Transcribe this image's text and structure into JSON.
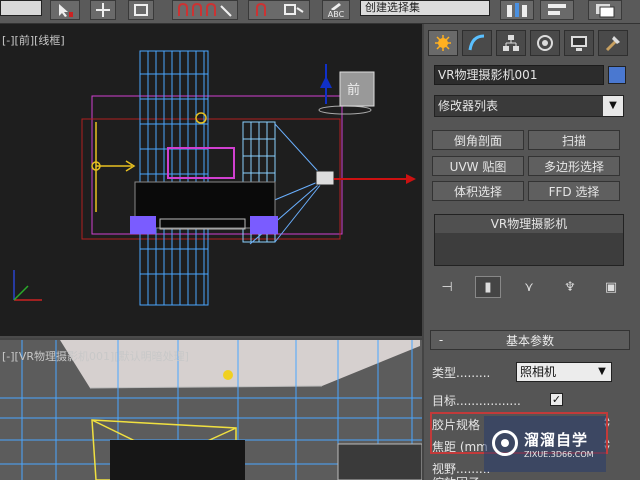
{
  "toolbar": {
    "selection_set": "创建选择集",
    "icons": [
      "select-object-icon",
      "select-move-icon",
      "snap-toggle-icon",
      "angle-snap-icon",
      "percent-snap-icon",
      "spinner-snap-icon",
      "edit-named-selection-icon",
      "mirror-icon",
      "align-icon",
      "layer-manager-icon",
      "graphite-ribbon-icon"
    ],
    "abc_label": "ABC"
  },
  "viewport_top": {
    "label": "[-][前][线框]"
  },
  "viewport_persp": {
    "label": "[-][VR物理摄影机001][默认明暗处理]"
  },
  "colors": {
    "grid_blue": "#4aa6ff",
    "selection_magenta": "#d040d0",
    "axis_red": "#cc1111",
    "axis_yellow": "#e8c020",
    "axis_blue": "#1030c8",
    "accent_red_box": "#c23a3a"
  },
  "command_panel": {
    "tabs": [
      "create-tab-icon",
      "modify-tab-icon",
      "hierarchy-tab-icon",
      "motion-tab-icon",
      "display-tab-icon",
      "utilities-tab-icon"
    ],
    "object_name": "VR物理摄影机001",
    "modifier_list": "修改器列表",
    "modifier_buttons": [
      [
        "倒角剖面",
        "扫描"
      ],
      [
        "UVW 贴图",
        "多边形选择"
      ],
      [
        "体积选择",
        "FFD 选择"
      ]
    ],
    "stack_item": "VR物理摄影机",
    "basic_params": {
      "rollout_title": "基本参数",
      "collapse": "-",
      "type_label": "类型.........",
      "type_value": "照相机",
      "target_label": "目标.................",
      "target_checked": "✓",
      "film_label": "胶片规格",
      "focal_label": "焦距 (mm",
      "fov_label": "视野.........",
      "zoom_label": "缩放因子"
    }
  },
  "watermark": {
    "title": "溜溜自学",
    "url": "ZIXUE.3D66.COM"
  }
}
